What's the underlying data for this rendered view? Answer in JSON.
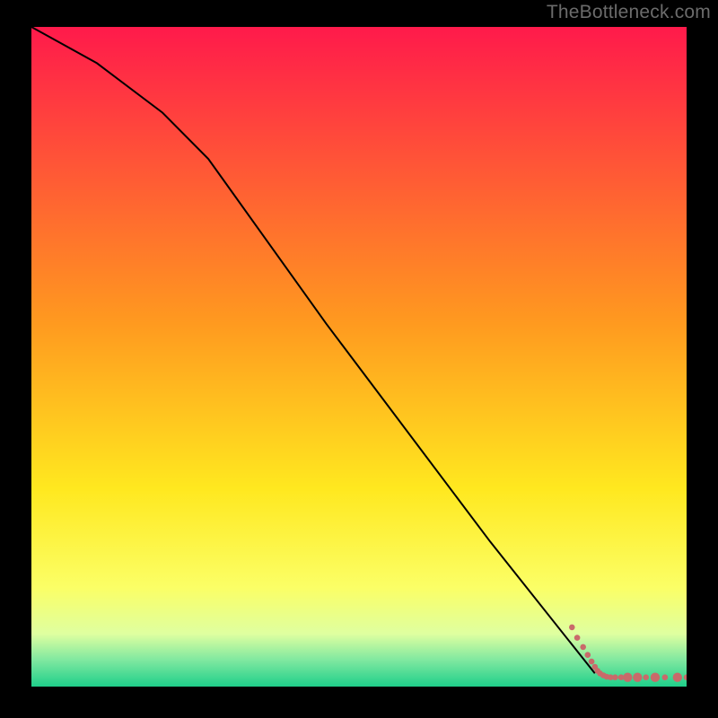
{
  "watermark": "TheBottleneck.com",
  "chart_data": {
    "type": "line",
    "title": "",
    "xlabel": "",
    "ylabel": "",
    "xlim": [
      0,
      100
    ],
    "ylim": [
      0,
      100
    ],
    "background_gradient": [
      {
        "stop": 0.0,
        "color": "#ff1a4b"
      },
      {
        "stop": 0.45,
        "color": "#ff9a1f"
      },
      {
        "stop": 0.7,
        "color": "#ffe81f"
      },
      {
        "stop": 0.85,
        "color": "#fbff66"
      },
      {
        "stop": 0.92,
        "color": "#dfffa0"
      },
      {
        "stop": 0.96,
        "color": "#7fe8a0"
      },
      {
        "stop": 1.0,
        "color": "#1fcf8a"
      }
    ],
    "series": [
      {
        "name": "curve",
        "type": "line",
        "color": "#000000",
        "x": [
          0,
          10,
          20,
          27,
          45,
          70,
          84,
          86
        ],
        "y": [
          100,
          94.5,
          87,
          80,
          55,
          22,
          4.5,
          2
        ]
      },
      {
        "name": "scatter-trail",
        "type": "scatter",
        "color": "#c96a6a",
        "radius_small": 3.3,
        "radius_large": 5.2,
        "points": [
          {
            "x": 82.5,
            "y": 9.0,
            "r": "small"
          },
          {
            "x": 83.3,
            "y": 7.4,
            "r": "small"
          },
          {
            "x": 84.2,
            "y": 6.0,
            "r": "small"
          },
          {
            "x": 84.9,
            "y": 4.8,
            "r": "small"
          },
          {
            "x": 85.5,
            "y": 3.8,
            "r": "small"
          },
          {
            "x": 86.0,
            "y": 3.0,
            "r": "small"
          },
          {
            "x": 86.4,
            "y": 2.4,
            "r": "small"
          },
          {
            "x": 86.8,
            "y": 2.0,
            "r": "small"
          },
          {
            "x": 87.3,
            "y": 1.7,
            "r": "small"
          },
          {
            "x": 87.8,
            "y": 1.5,
            "r": "small"
          },
          {
            "x": 88.4,
            "y": 1.4,
            "r": "small"
          },
          {
            "x": 89.1,
            "y": 1.4,
            "r": "small"
          },
          {
            "x": 90.0,
            "y": 1.4,
            "r": "small"
          },
          {
            "x": 91.0,
            "y": 1.4,
            "r": "large"
          },
          {
            "x": 92.5,
            "y": 1.4,
            "r": "large"
          },
          {
            "x": 93.8,
            "y": 1.4,
            "r": "small"
          },
          {
            "x": 95.2,
            "y": 1.4,
            "r": "large"
          },
          {
            "x": 96.7,
            "y": 1.4,
            "r": "small"
          },
          {
            "x": 98.6,
            "y": 1.4,
            "r": "large"
          },
          {
            "x": 100.0,
            "y": 1.4,
            "r": "small"
          }
        ]
      }
    ]
  }
}
